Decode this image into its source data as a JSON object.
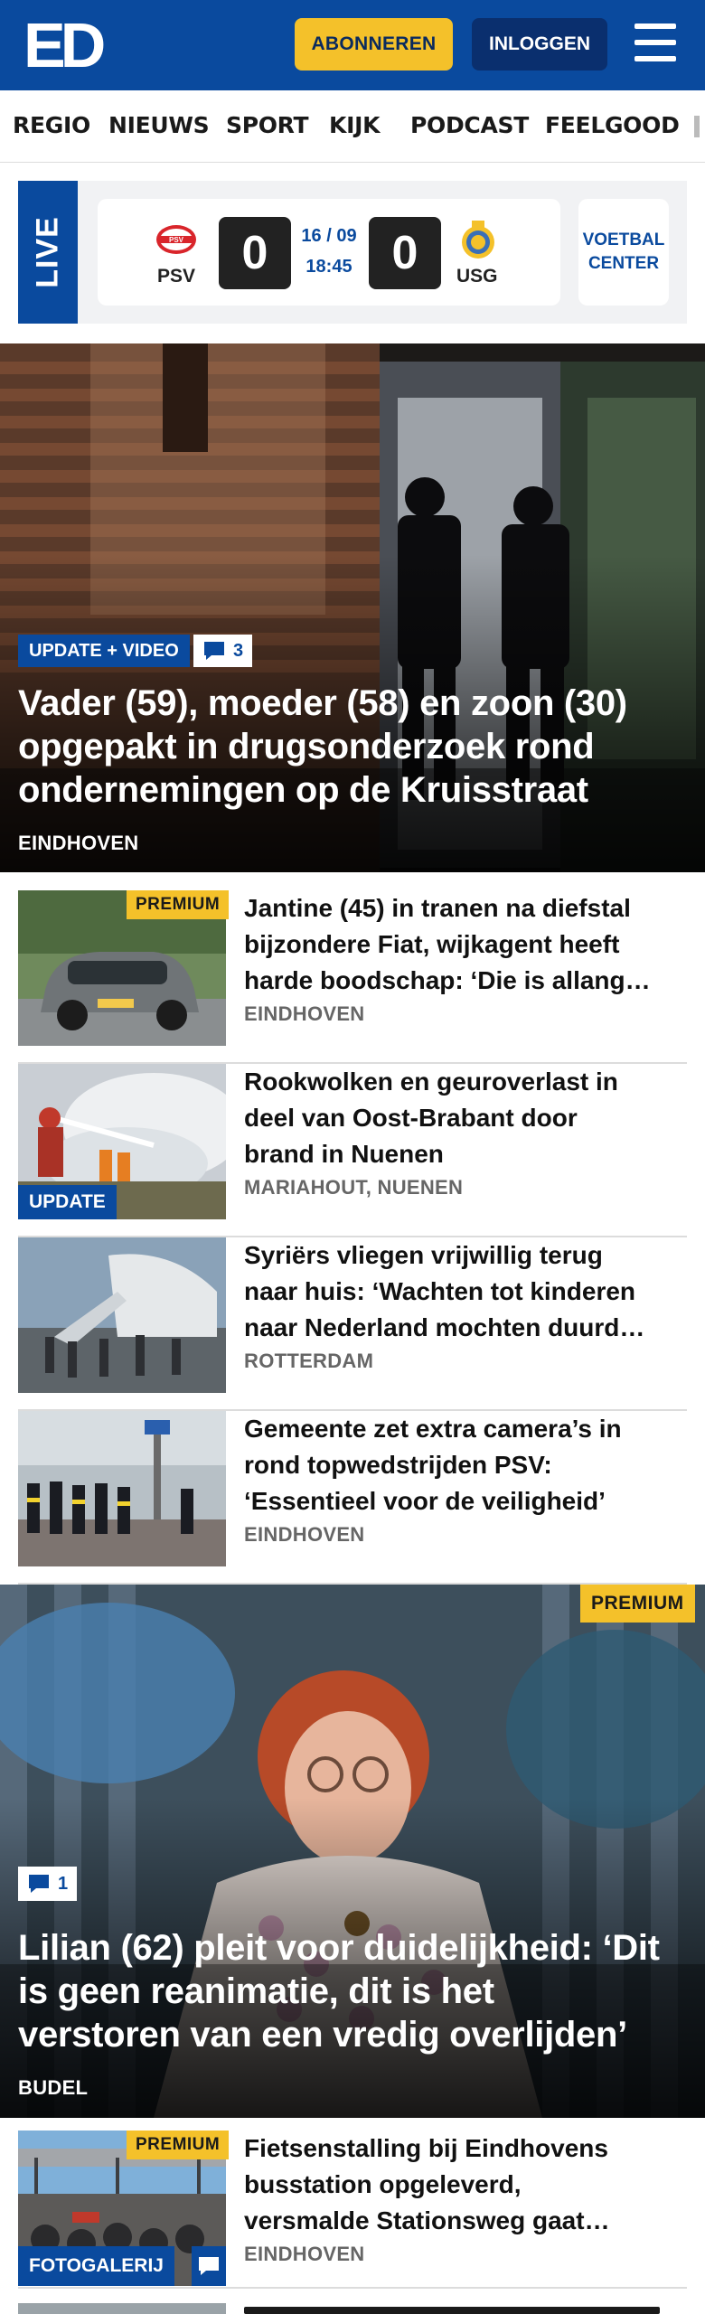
{
  "header": {
    "logo_text": "ED",
    "subscribe_label": "ABONNEREN",
    "login_label": "INLOGGEN",
    "menu_icon": "hamburger-menu-icon",
    "brand_color": "#0a4a9e",
    "accent_color": "#f4c12a"
  },
  "nav": {
    "items": [
      "REGIO",
      "NIEUWS",
      "SPORT",
      "KIJK",
      "PODCAST",
      "FEELGOOD"
    ]
  },
  "live": {
    "label": "LIVE",
    "home_team": "PSV",
    "away_team": "USG",
    "home_score": "0",
    "away_score": "0",
    "date": "16 / 09",
    "time": "18:45",
    "voetbalcenter_label_1": "VOETBAL",
    "voetbalcenter_label_2": "CENTER"
  },
  "hero": {
    "tag": "UPDATE + VIDEO",
    "comments": "3",
    "title_lines": [
      "Vader (59), moeder (58) en zoon (30)",
      "opgepakt in drugsonderzoek rond",
      "ondernemingen op de Kruisstraat"
    ],
    "location": "EINDHOVEN"
  },
  "articles": [
    {
      "title_lines": [
        "Jantine (45) in tranen na diefstal",
        "bijzondere Fiat, wijkagent heeft",
        "harde boodschap: ‘Die is allang…"
      ],
      "location": "EINDHOVEN",
      "badge": "PREMIUM"
    },
    {
      "title_lines": [
        "Rookwolken en geuroverlast in",
        "deel van Oost-Brabant door",
        "brand in Nuenen"
      ],
      "location": "MARIAHOUT, NUENEN",
      "badge": "UPDATE"
    },
    {
      "title_lines": [
        "Syriërs vliegen vrijwillig terug",
        "naar huis: ‘Wachten tot kinderen",
        "naar Nederland mochten duurd…"
      ],
      "location": "ROTTERDAM"
    },
    {
      "title_lines": [
        "Gemeente zet extra camera’s in",
        "rond topwedstrijden PSV:",
        "‘Essentieel voor de veiligheid’"
      ],
      "location": "EINDHOVEN"
    }
  ],
  "hero2": {
    "badge": "PREMIUM",
    "comments": "1",
    "title_lines": [
      "Lilian (62) pleit voor duidelijkheid: ‘Dit",
      "is geen reanimatie, dit is het",
      "verstoren van een vredig overlijden’"
    ],
    "location": "BUDEL"
  },
  "article_last": {
    "title_lines": [
      "Fietsenstalling bij Eindhovens",
      "busstation opgeleverd,",
      "versmalde Stationsweg gaat…"
    ],
    "location": "EINDHOVEN",
    "badge": "PREMIUM",
    "gallery_label": "FOTOGALERIJ"
  }
}
